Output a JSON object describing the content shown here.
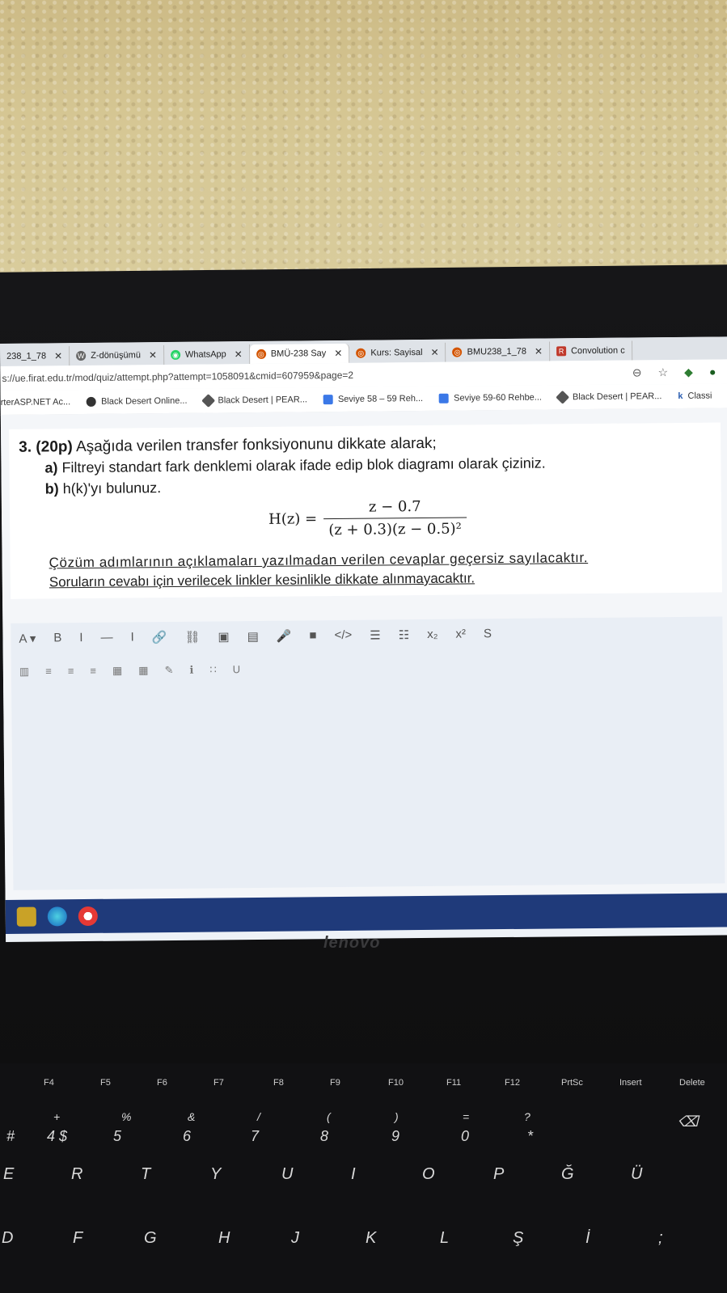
{
  "browser": {
    "tabs": [
      {
        "label": "238_1_78",
        "icon": "tab-icon",
        "active": false
      },
      {
        "label": "Z-dönüşümü",
        "icon": "wikipedia-icon",
        "active": false
      },
      {
        "label": "WhatsApp",
        "icon": "whatsapp-icon",
        "active": false
      },
      {
        "label": "BMÜ-238 Say",
        "icon": "moodle-icon",
        "active": true
      },
      {
        "label": "Kurs: Sayisal",
        "icon": "moodle-icon",
        "active": false
      },
      {
        "label": "BMU238_1_78",
        "icon": "moodle-icon",
        "active": false
      },
      {
        "label": "Convolution c",
        "icon": "r-icon",
        "active": false
      }
    ],
    "url": "s://ue.firat.edu.tr/mod/quiz/attempt.php?attempt=1058091&cmid=607959&page=2",
    "bookmarks": [
      {
        "label": "rterASP.NET Ac..."
      },
      {
        "label": "Black Desert Online..."
      },
      {
        "label": "Black Desert | PEAR..."
      },
      {
        "label": "Seviye 58 – 59 Reh..."
      },
      {
        "label": "Seviye 59-60 Rehbe..."
      },
      {
        "label": "Black Desert | PEAR..."
      },
      {
        "label": "Classi"
      }
    ]
  },
  "question": {
    "number": "3.",
    "points": "(20p)",
    "title": "Aşağıda verilen transfer fonksiyonunu dikkate alarak;",
    "part_a_label": "a)",
    "part_a": "Filtreyi standart fark denklemi olarak ifade edip blok diagramı olarak çiziniz.",
    "part_b_label": "b)",
    "part_b": "h(k)'yı bulunuz.",
    "formula_lhs": "H(z) =",
    "formula_num": "z − 0.7",
    "formula_den": "(z + 0.3)(z − 0.5)²",
    "note1": "Çözüm adımlarının açıklamaları yazılmadan verilen cevaplar geçersiz sayılacaktır.",
    "note2": "Soruların cevabı için verilecek linkler kesinlikle dikkate alınmayacaktır."
  },
  "editor_toolbar": [
    "A ▾",
    "B",
    "I",
    "—",
    "I",
    "🔗",
    "⛓",
    "▣",
    "▤",
    "🎤",
    "■",
    "</>",
    "☰",
    "☷",
    "x₂",
    "x²",
    "S"
  ],
  "editor_toolbar2": [
    "▥",
    "≡",
    "≡",
    "≡",
    "▦",
    "▦",
    "✎",
    "ℹ",
    "∷",
    "U"
  ],
  "laptop_brand": "lenovo",
  "keyboard": {
    "fkeys": [
      "F4",
      "F5",
      "F6",
      "F7",
      "F8",
      "F9",
      "F10",
      "F11",
      "F12",
      "PrtSc",
      "Insert",
      "Delete"
    ],
    "row1": [
      "#",
      "4 $",
      "5",
      "6",
      "7",
      "8",
      "9",
      "0",
      "*",
      "⌫"
    ],
    "row1_top": [
      "+",
      "%",
      "&",
      "/",
      "(",
      ")",
      "=",
      "?"
    ],
    "row2": [
      "E",
      "R",
      "T",
      "Y",
      "U",
      "I",
      "O",
      "P",
      "Ğ",
      "Ü"
    ],
    "row3": [
      "D",
      "F",
      "G",
      "H",
      "J",
      "K",
      "L",
      "Ş",
      "İ",
      ";"
    ]
  }
}
